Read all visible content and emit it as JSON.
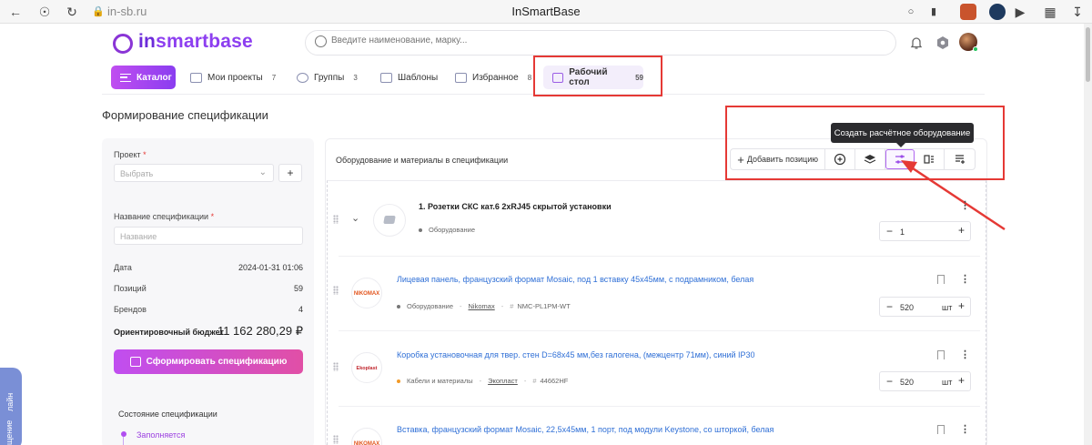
{
  "browser": {
    "url": "in-sb.ru",
    "title": "InSmartBase"
  },
  "header": {
    "logo_in": "in",
    "logo_rest": "smartbase",
    "search_placeholder": "Введите наименование, марку..."
  },
  "nav": {
    "catalog": "Каталог",
    "projects": "Мои проекты",
    "projects_count": "7",
    "groups": "Группы",
    "groups_count": "3",
    "templates": "Шаблоны",
    "favorites": "Избранное",
    "favorites_count": "8",
    "desktop": "Рабочий стол",
    "desktop_count": "59"
  },
  "page_title": "Формирование спецификации",
  "form": {
    "project_label": "Проект",
    "project_placeholder": "Выбрать",
    "name_label": "Название спецификации",
    "name_placeholder": "Название",
    "required_mark": "*",
    "plus": "+",
    "date_label": "Дата",
    "date_value": "2024-01-31 01:06",
    "positions_label": "Позиций",
    "positions_value": "59",
    "brands_label": "Брендов",
    "brands_value": "4",
    "budget_label": "Ориентировочный бюджет",
    "budget_value": "11 162 280,29 ₽",
    "generate_button": "Сформировать спецификацию",
    "state_title": "Состояние спецификации",
    "state_value": "Заполняется"
  },
  "side_widget": {
    "line1": "щение",
    "line2": "лайн"
  },
  "panel": {
    "title": "Оборудование и материалы в спецификации",
    "add_position": "Добавить позицию",
    "tooltip": "Создать расчётное оборудование"
  },
  "items": [
    {
      "title": "1. Розетки СКС кат.6 2xRJ45 скрытой установки",
      "category": "Оборудование",
      "qty": "1",
      "unit": ""
    },
    {
      "title": "Лицевая панель, французский формат Mosaic, под 1 вставку 45x45мм, с подрамником, белая",
      "category": "Оборудование",
      "brand": "Nikomax",
      "sku": "NMC-PL1PM-WT",
      "qty": "520",
      "unit": "шт",
      "logo": "NIKOMAX"
    },
    {
      "title": "Коробка установочная для твер. стен D=68x45 мм,без галогена, (межцентр 71мм), синий IP30",
      "category": "Кабели и материалы",
      "brand": "Экопласт",
      "sku": "44662HF",
      "qty": "520",
      "unit": "шт",
      "logo": "Ekoplast"
    },
    {
      "title": "Вставка, французский формат Mosaic, 22,5x45мм, 1 порт, под модули Keystone, со шторкой, белая",
      "logo": "NIKOMAX"
    }
  ],
  "glyphs": {
    "minus": "−",
    "plus": "+",
    "hash": "#",
    "kebab": "⋮",
    "chevron": "⌄",
    "dash": "-"
  },
  "colors": {
    "accent": "#8a3df0",
    "link": "#2f6fd6",
    "highlight": "#e53935"
  }
}
